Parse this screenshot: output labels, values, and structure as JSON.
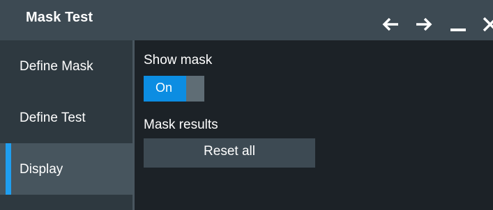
{
  "window": {
    "title": "Mask Test",
    "controls": [
      {
        "name": "back-arrow-icon"
      },
      {
        "name": "forward-arrow-icon"
      },
      {
        "name": "minimize-icon"
      },
      {
        "name": "close-icon"
      }
    ]
  },
  "sidebar": {
    "items": [
      {
        "label": "Define Mask",
        "active": false
      },
      {
        "label": "Define Test",
        "active": false
      },
      {
        "label": "Display",
        "active": true
      }
    ]
  },
  "content": {
    "show_mask_label": "Show mask",
    "show_mask_toggle": {
      "value": "On",
      "state": true
    },
    "mask_results_label": "Mask results",
    "reset_button_label": "Reset all"
  },
  "colors": {
    "accent": "#1f9ef0",
    "toggle_on": "#0c8de2",
    "titlebar_bg": "#3d4a53",
    "sidebar_bg": "#2e3940",
    "content_bg": "#1c2227"
  }
}
